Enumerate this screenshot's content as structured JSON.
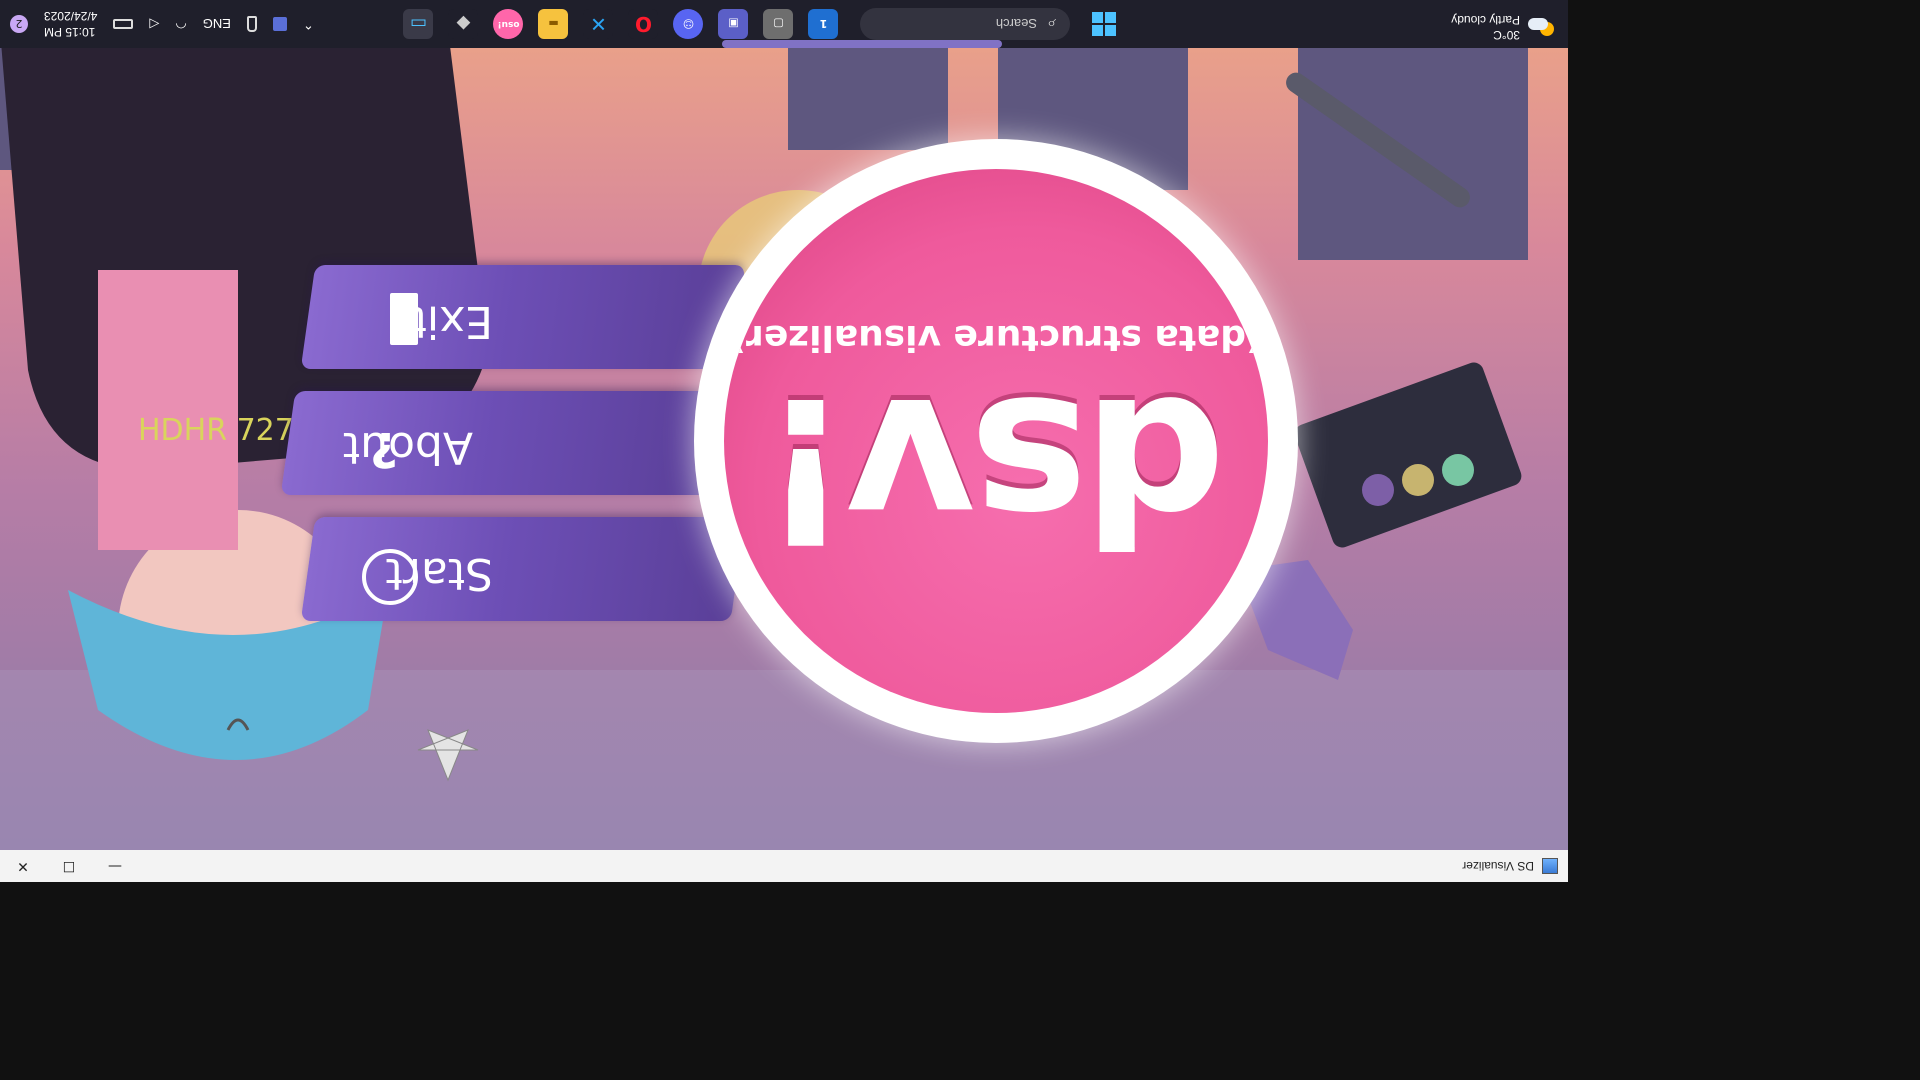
{
  "window": {
    "title": "DS Visualizer",
    "minimize_glyph": "—",
    "maximize_glyph": "☐",
    "close_glyph": "✕"
  },
  "app": {
    "logo_main": "dsv!",
    "logo_sub": "(data structure visualizer)",
    "menu": {
      "start_label": "Start",
      "about_label": "About",
      "exit_label": "Exit"
    },
    "colors": {
      "accent_pink": "#f05aa0",
      "button_purple": "#6d4fb6"
    },
    "art_text": "HDHR 727"
  },
  "taskbar": {
    "weather": {
      "temperature": "30°C",
      "condition": "Partly cloudy",
      "icon": "partly-cloudy-icon"
    },
    "search_placeholder": "Search",
    "apps": [
      {
        "name": "file-explorer-icon",
        "glyph": "▭"
      },
      {
        "name": "inkscape-icon",
        "glyph": "◆"
      },
      {
        "name": "osu-icon",
        "glyph": "osu!"
      },
      {
        "name": "folder-icon",
        "glyph": "▬"
      },
      {
        "name": "vscode-icon",
        "glyph": "✕"
      },
      {
        "name": "opera-icon",
        "glyph": "O"
      },
      {
        "name": "discord-icon",
        "glyph": "☺"
      },
      {
        "name": "teams-icon",
        "glyph": "▣"
      },
      {
        "name": "window-app-icon",
        "glyph": "▢"
      },
      {
        "name": "onepassword-icon",
        "glyph": "1"
      }
    ],
    "tray": {
      "chevron": "⌃",
      "language": "ENG",
      "date": "4/24/2023",
      "time": "10:15 PM",
      "notification_count": "2"
    }
  }
}
